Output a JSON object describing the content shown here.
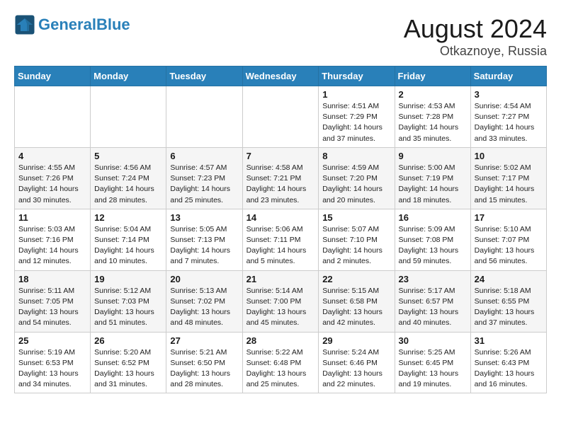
{
  "header": {
    "logo_line1": "General",
    "logo_line2": "Blue",
    "month_year": "August 2024",
    "location": "Otkaznoye, Russia"
  },
  "weekdays": [
    "Sunday",
    "Monday",
    "Tuesday",
    "Wednesday",
    "Thursday",
    "Friday",
    "Saturday"
  ],
  "weeks": [
    [
      {
        "day": "",
        "info": ""
      },
      {
        "day": "",
        "info": ""
      },
      {
        "day": "",
        "info": ""
      },
      {
        "day": "",
        "info": ""
      },
      {
        "day": "1",
        "info": "Sunrise: 4:51 AM\nSunset: 7:29 PM\nDaylight: 14 hours\nand 37 minutes."
      },
      {
        "day": "2",
        "info": "Sunrise: 4:53 AM\nSunset: 7:28 PM\nDaylight: 14 hours\nand 35 minutes."
      },
      {
        "day": "3",
        "info": "Sunrise: 4:54 AM\nSunset: 7:27 PM\nDaylight: 14 hours\nand 33 minutes."
      }
    ],
    [
      {
        "day": "4",
        "info": "Sunrise: 4:55 AM\nSunset: 7:26 PM\nDaylight: 14 hours\nand 30 minutes."
      },
      {
        "day": "5",
        "info": "Sunrise: 4:56 AM\nSunset: 7:24 PM\nDaylight: 14 hours\nand 28 minutes."
      },
      {
        "day": "6",
        "info": "Sunrise: 4:57 AM\nSunset: 7:23 PM\nDaylight: 14 hours\nand 25 minutes."
      },
      {
        "day": "7",
        "info": "Sunrise: 4:58 AM\nSunset: 7:21 PM\nDaylight: 14 hours\nand 23 minutes."
      },
      {
        "day": "8",
        "info": "Sunrise: 4:59 AM\nSunset: 7:20 PM\nDaylight: 14 hours\nand 20 minutes."
      },
      {
        "day": "9",
        "info": "Sunrise: 5:00 AM\nSunset: 7:19 PM\nDaylight: 14 hours\nand 18 minutes."
      },
      {
        "day": "10",
        "info": "Sunrise: 5:02 AM\nSunset: 7:17 PM\nDaylight: 14 hours\nand 15 minutes."
      }
    ],
    [
      {
        "day": "11",
        "info": "Sunrise: 5:03 AM\nSunset: 7:16 PM\nDaylight: 14 hours\nand 12 minutes."
      },
      {
        "day": "12",
        "info": "Sunrise: 5:04 AM\nSunset: 7:14 PM\nDaylight: 14 hours\nand 10 minutes."
      },
      {
        "day": "13",
        "info": "Sunrise: 5:05 AM\nSunset: 7:13 PM\nDaylight: 14 hours\nand 7 minutes."
      },
      {
        "day": "14",
        "info": "Sunrise: 5:06 AM\nSunset: 7:11 PM\nDaylight: 14 hours\nand 5 minutes."
      },
      {
        "day": "15",
        "info": "Sunrise: 5:07 AM\nSunset: 7:10 PM\nDaylight: 14 hours\nand 2 minutes."
      },
      {
        "day": "16",
        "info": "Sunrise: 5:09 AM\nSunset: 7:08 PM\nDaylight: 13 hours\nand 59 minutes."
      },
      {
        "day": "17",
        "info": "Sunrise: 5:10 AM\nSunset: 7:07 PM\nDaylight: 13 hours\nand 56 minutes."
      }
    ],
    [
      {
        "day": "18",
        "info": "Sunrise: 5:11 AM\nSunset: 7:05 PM\nDaylight: 13 hours\nand 54 minutes."
      },
      {
        "day": "19",
        "info": "Sunrise: 5:12 AM\nSunset: 7:03 PM\nDaylight: 13 hours\nand 51 minutes."
      },
      {
        "day": "20",
        "info": "Sunrise: 5:13 AM\nSunset: 7:02 PM\nDaylight: 13 hours\nand 48 minutes."
      },
      {
        "day": "21",
        "info": "Sunrise: 5:14 AM\nSunset: 7:00 PM\nDaylight: 13 hours\nand 45 minutes."
      },
      {
        "day": "22",
        "info": "Sunrise: 5:15 AM\nSunset: 6:58 PM\nDaylight: 13 hours\nand 42 minutes."
      },
      {
        "day": "23",
        "info": "Sunrise: 5:17 AM\nSunset: 6:57 PM\nDaylight: 13 hours\nand 40 minutes."
      },
      {
        "day": "24",
        "info": "Sunrise: 5:18 AM\nSunset: 6:55 PM\nDaylight: 13 hours\nand 37 minutes."
      }
    ],
    [
      {
        "day": "25",
        "info": "Sunrise: 5:19 AM\nSunset: 6:53 PM\nDaylight: 13 hours\nand 34 minutes."
      },
      {
        "day": "26",
        "info": "Sunrise: 5:20 AM\nSunset: 6:52 PM\nDaylight: 13 hours\nand 31 minutes."
      },
      {
        "day": "27",
        "info": "Sunrise: 5:21 AM\nSunset: 6:50 PM\nDaylight: 13 hours\nand 28 minutes."
      },
      {
        "day": "28",
        "info": "Sunrise: 5:22 AM\nSunset: 6:48 PM\nDaylight: 13 hours\nand 25 minutes."
      },
      {
        "day": "29",
        "info": "Sunrise: 5:24 AM\nSunset: 6:46 PM\nDaylight: 13 hours\nand 22 minutes."
      },
      {
        "day": "30",
        "info": "Sunrise: 5:25 AM\nSunset: 6:45 PM\nDaylight: 13 hours\nand 19 minutes."
      },
      {
        "day": "31",
        "info": "Sunrise: 5:26 AM\nSunset: 6:43 PM\nDaylight: 13 hours\nand 16 minutes."
      }
    ]
  ]
}
